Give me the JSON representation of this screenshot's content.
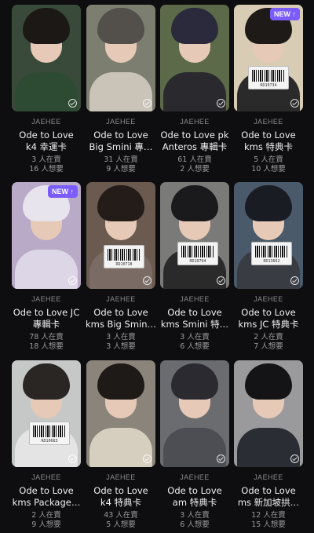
{
  "colors": {
    "background": "#0e0e10",
    "badge": "#7b5cff"
  },
  "cards": [
    {
      "artist": "JAEHEE",
      "title1": "Ode to Love",
      "title2": "k4 幸運卡",
      "selling": "3 人在賣",
      "wanted": "16 人想要",
      "badge": null,
      "barcode": null,
      "bg": "#3a4a3a",
      "hair": "#1c1816",
      "body": "#2d4a32"
    },
    {
      "artist": "JAEHEE",
      "title1": "Ode to Love",
      "title2": "Big Smini 專…",
      "selling": "31 人在賣",
      "wanted": "9 人想要",
      "badge": null,
      "barcode": null,
      "bg": "#7c7f70",
      "hair": "#53504c",
      "body": "#c9c3b8"
    },
    {
      "artist": "JAEHEE",
      "title1": "Ode to Love pk",
      "title2": "Anteros 專輯卡",
      "selling": "61 人在賣",
      "wanted": "2 人想要",
      "badge": null,
      "barcode": null,
      "bg": "#5c6a4a",
      "hair": "#2a2a3c",
      "body": "#2a2a2e"
    },
    {
      "artist": "JAEHEE",
      "title1": "Ode to Love",
      "title2": "kms 特典卡",
      "selling": "5 人在賣",
      "wanted": "10 人想要",
      "badge": "NEW ↑",
      "barcode": "RD10734",
      "bg": "#d8cdb4",
      "hair": "#1e1a18",
      "body": "#2a2a2a"
    },
    {
      "artist": "JAEHEE",
      "title1": "Ode to Love JC",
      "title2": "專輯卡",
      "selling": "78 人在賣",
      "wanted": "18 人想要",
      "badge": "NEW ↑",
      "barcode": null,
      "bg": "#b9aac8",
      "hair": "#e8e4ee",
      "body": "#ddd6e6"
    },
    {
      "artist": "JAEHEE",
      "title1": "Ode to Love",
      "title2": "kms Big Smin…",
      "selling": "3 人在賣",
      "wanted": "3 人想要",
      "badge": null,
      "barcode": "RD10718",
      "bg": "#6a5a50",
      "hair": "#241c18",
      "body": "#7a6c64"
    },
    {
      "artist": "JAEHEE",
      "title1": "Ode to Love",
      "title2": "kms Smini 特…",
      "selling": "3 人在賣",
      "wanted": "6 人想要",
      "badge": null,
      "barcode": "RD10704",
      "bg": "#7a7a78",
      "hair": "#1a1a1c",
      "body": "#2a2a2a"
    },
    {
      "artist": "JAEHEE",
      "title1": "Ode to Love",
      "title2": "kms JC 特典卡",
      "selling": "2 人在賣",
      "wanted": "7 人想要",
      "badge": null,
      "barcode": "RD13662",
      "bg": "#4a5a6a",
      "hair": "#1a1c24",
      "body": "#3a3c44"
    },
    {
      "artist": "JAEHEE",
      "title1": "Ode to Love",
      "title2": "kms Package…",
      "selling": "2 人在賣",
      "wanted": "9 人想要",
      "badge": null,
      "barcode": "RD10683",
      "bg": "#c6c8c8",
      "hair": "#2a2624",
      "body": "#e4e4e4"
    },
    {
      "artist": "JAEHEE",
      "title1": "Ode to Love",
      "title2": "k4 特典卡",
      "selling": "43 人在賣",
      "wanted": "5 人想要",
      "badge": null,
      "barcode": null,
      "bg": "#8a847a",
      "hair": "#1e1a18",
      "body": "#d6cfc0"
    },
    {
      "artist": "JAEHEE",
      "title1": "Ode to Love",
      "title2": "am 特典卡",
      "selling": "3 人在賣",
      "wanted": "6 人想要",
      "badge": null,
      "barcode": null,
      "bg": "#6a6c70",
      "hair": "#2a2a30",
      "body": "#4c4e54"
    },
    {
      "artist": "JAEHEE",
      "title1": "Ode to Love",
      "title2": "ms 新加坡拱…",
      "selling": "12 人在賣",
      "wanted": "15 人想要",
      "badge": null,
      "barcode": null,
      "bg": "#9a9a9c",
      "hair": "#141416",
      "body": "#2a2e34"
    }
  ]
}
